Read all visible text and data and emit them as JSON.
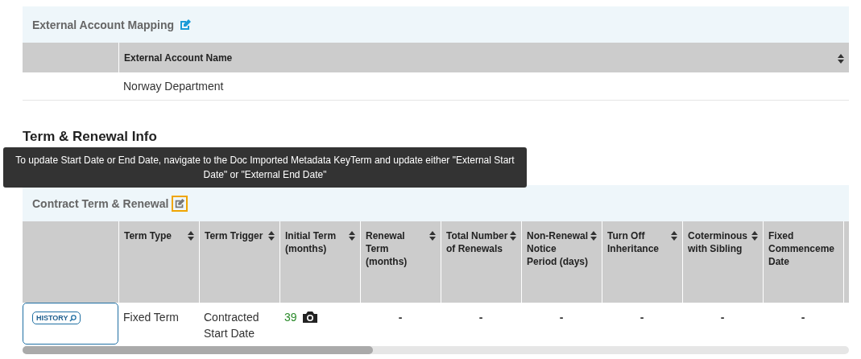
{
  "external_account_mapping": {
    "title": "External Account Mapping",
    "edit_focused": false,
    "columns": [
      {
        "sortable": false
      },
      {
        "label": "External Account Name",
        "sortable": true
      }
    ],
    "rows": [
      [
        "",
        "Norway Department"
      ]
    ]
  },
  "term_heading": "Term & Renewal Info",
  "tooltip": "To update Start Date or End Date, navigate to the Doc Imported Metadata KeyTerm and update either \"External Start Date\" or \"External End Date\"",
  "contract_term": {
    "title": "Contract Term & Renewal",
    "edit_focused": true,
    "columns": [
      {
        "sortable": false
      },
      {
        "label": "Term Type",
        "sortable": true
      },
      {
        "label": "Term Trigger",
        "sortable": true
      },
      {
        "label": "Initial Term (months)",
        "sortable": true
      },
      {
        "label": "Renewal Term (months)",
        "sortable": true
      },
      {
        "label": "Total Number of Renewals",
        "sortable": true
      },
      {
        "label": "Non-Renewal Notice Period (days)",
        "sortable": true
      },
      {
        "label": "Turn Off Inheritance",
        "sortable": true
      },
      {
        "label": "Coterminous with Sibling",
        "sortable": true
      },
      {
        "label": "Fixed Commenceme Date",
        "sortable": false
      }
    ],
    "rows": [
      [
        {
          "kind": "history",
          "text": "HISTORY"
        },
        {
          "kind": "text",
          "text": "Fixed Term"
        },
        {
          "kind": "text",
          "text": "Contracted Start Date"
        },
        {
          "kind": "snapshot",
          "text": "39"
        },
        {
          "kind": "dash",
          "text": "-"
        },
        {
          "kind": "dash",
          "text": "-"
        },
        {
          "kind": "dash",
          "text": "-"
        },
        {
          "kind": "dash",
          "text": "-"
        },
        {
          "kind": "dash",
          "text": "-"
        },
        {
          "kind": "dash",
          "text": "-"
        }
      ]
    ]
  }
}
